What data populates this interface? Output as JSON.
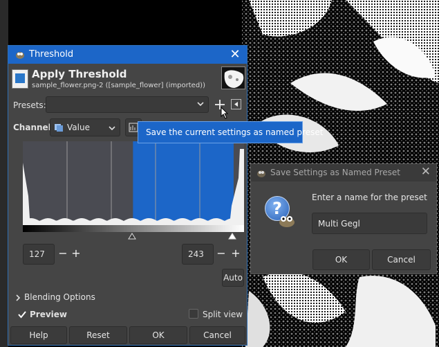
{
  "threshold_dialog": {
    "title": "Threshold",
    "heading": "Apply Threshold",
    "subtitle": "sample_flower.png-2 ([sample_flower] (imported))",
    "presets_label": "Presets:",
    "presets_value": "",
    "channel_label": "Channel:",
    "channel_value": "Value",
    "low_value": "127",
    "high_value": "243",
    "auto_label": "Auto",
    "blending_label": "Blending Options",
    "preview_label": "Preview",
    "preview_checked": true,
    "split_view_label": "Split view",
    "split_view_checked": false,
    "buttons": {
      "help": "Help",
      "reset": "Reset",
      "ok": "OK",
      "cancel": "Cancel"
    },
    "selection_range": [
      127,
      243
    ]
  },
  "tooltip": {
    "text": "Save the current settings as named preset"
  },
  "save_preset_dialog": {
    "title": "Save Settings as Named Preset",
    "message": "Enter a name for the preset",
    "name_value": "Multi Gegl",
    "ok_label": "OK",
    "cancel_label": "Cancel"
  },
  "colors": {
    "accent": "#1c66c8",
    "dialog_bg": "#454545",
    "histogram_bg": "#4a4b52"
  },
  "icons": {
    "close": "close-icon",
    "add": "plus-icon",
    "menu": "triangle-left-icon",
    "expander": "chevron-right-icon",
    "question": "question-icon",
    "app": "gimp-icon"
  }
}
